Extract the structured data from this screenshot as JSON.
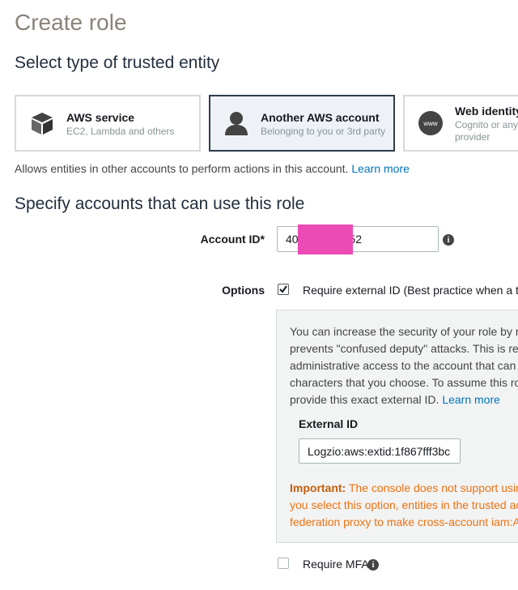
{
  "page": {
    "title": "Create role",
    "section_trusted_entity": "Select type of trusted entity",
    "section_accounts": "Specify accounts that can use this role"
  },
  "entity_cards": [
    {
      "title": "AWS service",
      "subtitle": "EC2, Lambda and others",
      "icon": "cube-icon",
      "selected": false
    },
    {
      "title": "Another AWS account",
      "subtitle": "Belonging to you or 3rd party",
      "icon": "user-icon",
      "selected": true
    },
    {
      "title": "Web identity",
      "subtitle_line1": "Cognito or any",
      "subtitle_line2": "provider",
      "icon": "www-globe-icon",
      "selected": false
    }
  ],
  "description": {
    "text": "Allows entities in other accounts to perform actions in this account.",
    "link": "Learn more"
  },
  "account_id": {
    "label": "Account ID*",
    "value_prefix": "40",
    "value_suffix": "52",
    "redaction_color": "#ec4ab5"
  },
  "options": {
    "label": "Options",
    "require_external_id": {
      "label": "Require external ID (Best practice when a th",
      "checked": true
    },
    "require_mfa": {
      "label": "Require MFA",
      "checked": false
    }
  },
  "external_id_panel": {
    "lines": [
      "You can increase the security of your role by r",
      "prevents \"confused deputy\" attacks. This is re",
      "administrative access to the account that can",
      "characters that you choose. To assume this ro"
    ],
    "last_line": "provide this exact external ID.",
    "learn_more": "Learn more",
    "field_label": "External ID",
    "field_value": "Logzio:aws:extid:1f867fff3bc",
    "important_label": "Important:",
    "important_line1": "The console does not support usin",
    "important_line2": "you select this option, entities in the trusted ac",
    "important_line3": "federation proxy to make cross-account iam:A"
  },
  "colors": {
    "accent_link": "#0073bb",
    "selected_border": "#2e3b4e",
    "warning": "#ec7211"
  }
}
